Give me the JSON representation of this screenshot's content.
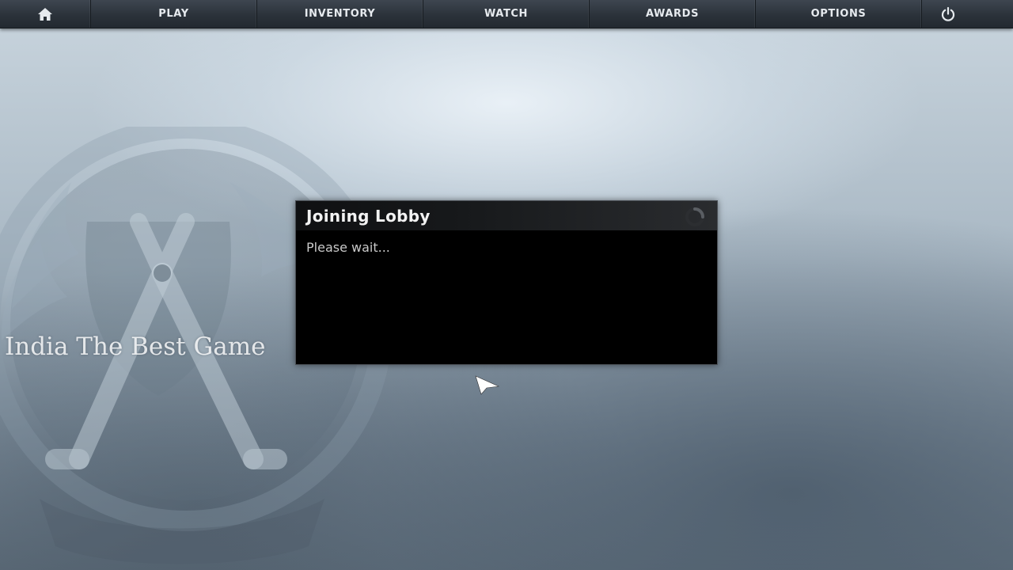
{
  "nav": {
    "home_icon": "home-icon",
    "items": [
      {
        "label": "PLAY"
      },
      {
        "label": "INVENTORY"
      },
      {
        "label": "WATCH"
      },
      {
        "label": "AWARDS"
      },
      {
        "label": "OPTIONS"
      }
    ],
    "power_icon": "power-icon"
  },
  "dialog": {
    "title": "Joining Lobby",
    "message": "Please wait...",
    "spinner_icon": "loading-spinner-icon"
  },
  "watermark": {
    "text": "India The Best Game"
  },
  "background": {
    "emblem_icon": "counter-terrorist-emblem-icon"
  },
  "colors": {
    "navbar": "#2b323a",
    "nav_text": "#e6eaee",
    "dialog_bg": "#000000",
    "dialog_title": "#f2f2f2",
    "dialog_text": "#c9c9c9"
  }
}
